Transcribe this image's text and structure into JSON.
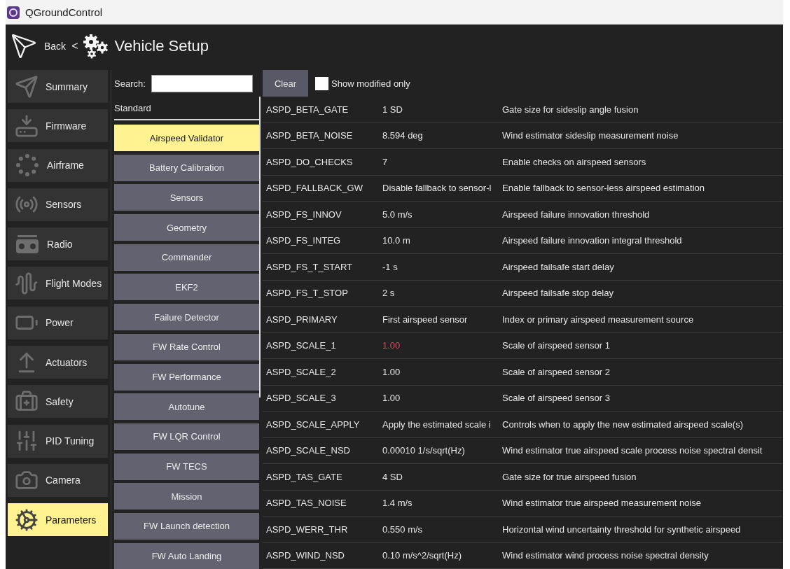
{
  "window": {
    "title": "QGroundControl"
  },
  "header": {
    "back": "Back",
    "separator": "<",
    "title": "Vehicle Setup"
  },
  "sidebar": {
    "items": [
      {
        "label": "Summary",
        "selected": false
      },
      {
        "label": "Firmware",
        "selected": false
      },
      {
        "label": "Airframe",
        "selected": false
      },
      {
        "label": "Sensors",
        "selected": false
      },
      {
        "label": "Radio",
        "selected": false
      },
      {
        "label": "Flight Modes",
        "selected": false
      },
      {
        "label": "Power",
        "selected": false
      },
      {
        "label": "Actuators",
        "selected": false
      },
      {
        "label": "Safety",
        "selected": false
      },
      {
        "label": "PID Tuning",
        "selected": false
      },
      {
        "label": "Camera",
        "selected": false
      },
      {
        "label": "Parameters",
        "selected": true
      }
    ]
  },
  "search": {
    "label": "Search:"
  },
  "groups": {
    "heading": "Standard",
    "items": [
      {
        "label": "Airspeed Validator",
        "selected": true
      },
      {
        "label": "Battery Calibration",
        "selected": false
      },
      {
        "label": "Sensors",
        "selected": false
      },
      {
        "label": "Geometry",
        "selected": false
      },
      {
        "label": "Commander",
        "selected": false
      },
      {
        "label": "EKF2",
        "selected": false
      },
      {
        "label": "Failure Detector",
        "selected": false
      },
      {
        "label": "FW Rate Control",
        "selected": false
      },
      {
        "label": "FW Performance",
        "selected": false
      },
      {
        "label": "Autotune",
        "selected": false
      },
      {
        "label": "FW LQR Control",
        "selected": false
      },
      {
        "label": "FW TECS",
        "selected": false
      },
      {
        "label": "Mission",
        "selected": false
      },
      {
        "label": "FW Launch detection",
        "selected": false
      },
      {
        "label": "FW Auto Landing",
        "selected": false
      }
    ]
  },
  "toolbar": {
    "clear": "Clear",
    "show_modified_only": {
      "label": "Show modified only",
      "checked": false
    }
  },
  "parameters": [
    {
      "name": "ASPD_BETA_GATE",
      "value": "1 SD",
      "description": "Gate size for sideslip angle fusion",
      "modified": false
    },
    {
      "name": "ASPD_BETA_NOISE",
      "value": "8.594 deg",
      "description": "Wind estimator sideslip measurement noise",
      "modified": false
    },
    {
      "name": "ASPD_DO_CHECKS",
      "value": "7",
      "description": "Enable checks on airspeed sensors",
      "modified": false
    },
    {
      "name": "ASPD_FALLBACK_GW",
      "value": "Disable fallback to sensor-l",
      "description": "Enable fallback to sensor-less airspeed estimation",
      "modified": false
    },
    {
      "name": "ASPD_FS_INNOV",
      "value": "5.0 m/s",
      "description": "Airspeed failure innovation threshold",
      "modified": false
    },
    {
      "name": "ASPD_FS_INTEG",
      "value": "10.0 m",
      "description": "Airspeed failure innovation integral threshold",
      "modified": false
    },
    {
      "name": "ASPD_FS_T_START",
      "value": "-1 s",
      "description": "Airspeed failsafe start delay",
      "modified": false
    },
    {
      "name": "ASPD_FS_T_STOP",
      "value": "2 s",
      "description": "Airspeed failsafe stop delay",
      "modified": false
    },
    {
      "name": "ASPD_PRIMARY",
      "value": "First airspeed sensor",
      "description": "Index or primary airspeed measurement source",
      "modified": false
    },
    {
      "name": "ASPD_SCALE_1",
      "value": "1.00",
      "description": "Scale of airspeed sensor 1",
      "modified": true
    },
    {
      "name": "ASPD_SCALE_2",
      "value": "1.00",
      "description": "Scale of airspeed sensor 2",
      "modified": false
    },
    {
      "name": "ASPD_SCALE_3",
      "value": "1.00",
      "description": "Scale of airspeed sensor 3",
      "modified": false
    },
    {
      "name": "ASPD_SCALE_APPLY",
      "value": "Apply the estimated scale i",
      "description": "Controls when to apply the new estimated airspeed scale(s)",
      "modified": false
    },
    {
      "name": "ASPD_SCALE_NSD",
      "value": "0.00010 1/s/sqrt(Hz)",
      "description": "Wind estimator true airspeed scale process noise spectral densit",
      "modified": false
    },
    {
      "name": "ASPD_TAS_GATE",
      "value": "4 SD",
      "description": "Gate size for true airspeed fusion",
      "modified": false
    },
    {
      "name": "ASPD_TAS_NOISE",
      "value": "1.4 m/s",
      "description": "Wind estimator true airspeed measurement noise",
      "modified": false
    },
    {
      "name": "ASPD_WERR_THR",
      "value": "0.550 m/s",
      "description": "Horizontal wind uncertainty threshold for synthetic airspeed",
      "modified": false
    },
    {
      "name": "ASPD_WIND_NSD",
      "value": "0.10 m/s^2/sqrt(Hz)",
      "description": "Wind estimator wind process noise spectral density",
      "modified": false
    }
  ]
}
